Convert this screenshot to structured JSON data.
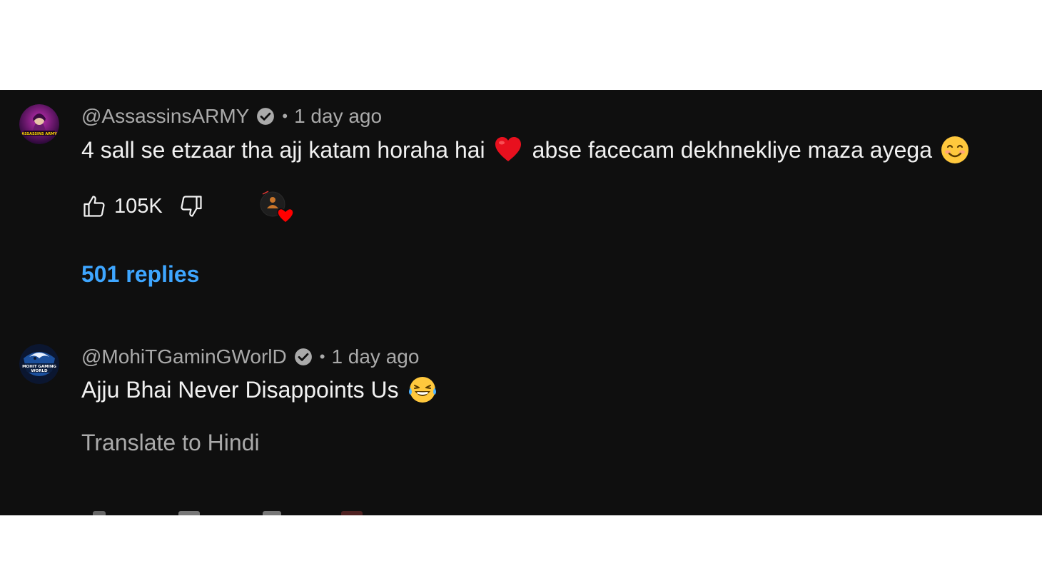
{
  "comments": [
    {
      "handle": "@AssassinsARMY",
      "time": "1 day ago",
      "text": "4 sall se etzaar tha ajj katam horaha hai",
      "text_tail": "abse facecam dekhnekliye maza ayega",
      "avatar_text": "ASSASSINS ARMY",
      "likes": "105K",
      "replies": "501 replies"
    },
    {
      "handle": "@MohiTGaminGWorlD",
      "time": "1 day ago",
      "text": "Ajju Bhai Never Disappoints Us",
      "avatar_text": "MOHIT GAMING WORLD",
      "translate": "Translate to Hindi"
    }
  ],
  "separator": "•",
  "colors": {
    "background": "#0f0f0f",
    "link": "#3ea6ff",
    "muted": "#aaaaaa",
    "text": "#f1f1f1",
    "heart": "#ff0000"
  },
  "icons": [
    "verified-badge-icon",
    "heart-emoji",
    "smiling-face-emoji",
    "tears-of-joy-emoji",
    "thumbs-up-icon",
    "thumbs-down-icon",
    "creator-heart-icon"
  ]
}
